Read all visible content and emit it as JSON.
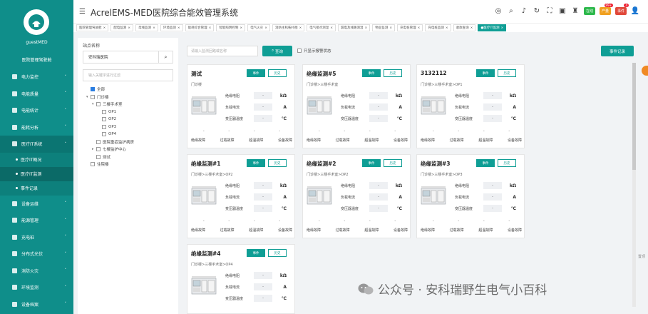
{
  "sidebar": {
    "user_name": "guestMED",
    "user_role": "医院管理驾驶舱",
    "items": [
      {
        "label": "电力监控",
        "icon": "lightning-icon"
      },
      {
        "label": "电能质量",
        "icon": "quality-icon"
      },
      {
        "label": "电能统计",
        "icon": "bar-chart-icon"
      },
      {
        "label": "能耗分析",
        "icon": "analysis-icon"
      },
      {
        "label": "医疗IT系统",
        "icon": "medical-icon",
        "open": true
      },
      {
        "label": "设备运维",
        "icon": "maintenance-icon"
      },
      {
        "label": "能源管理",
        "icon": "energy-icon"
      },
      {
        "label": "充电桩",
        "icon": "charger-icon"
      },
      {
        "label": "分布式光伏",
        "icon": "solar-icon"
      },
      {
        "label": "消防火灾",
        "icon": "fire-icon"
      },
      {
        "label": "环境监测",
        "icon": "environment-icon"
      },
      {
        "label": "设备档案",
        "icon": "archive-icon"
      },
      {
        "label": "运维管理",
        "icon": "ops-icon"
      }
    ],
    "sub_items": [
      {
        "label": "医疗IT概况"
      },
      {
        "label": "医疗IT监测",
        "active": true
      },
      {
        "label": "事件记录"
      }
    ]
  },
  "header": {
    "title": "AcrelEMS-MED医院综合能效管理系统",
    "badges": [
      {
        "label": "在线",
        "color": "#2db84c"
      },
      {
        "label": "产量",
        "color": "#f0a020",
        "count": "99+"
      },
      {
        "label": "事件",
        "color": "#e0483a",
        "count": "4"
      }
    ]
  },
  "tabs": [
    "医院管理驾驶舱",
    "配电监测",
    "母线监测",
    "环境监测",
    "能耗综合管理",
    "智能照明控制",
    "电气火灾",
    "消防主机拓扑图",
    "电气接点测温",
    "漏电及线路测温",
    "物业监测",
    "充电桩管理",
    "充电桩监测",
    "收款查询",
    "医疗IT监测"
  ],
  "tree": {
    "label": "站点名称",
    "selected_site": "安科瑞医院",
    "search_placeholder": "输入关键字进行过滤",
    "nodes": [
      {
        "label": "全部",
        "level": 0,
        "checked": true
      },
      {
        "label": "门诊楼",
        "level": 0,
        "toggle": "▾"
      },
      {
        "label": "三楼手术室",
        "level": 1,
        "toggle": "▾"
      },
      {
        "label": "OP1",
        "level": 2
      },
      {
        "label": "OP2",
        "level": 2
      },
      {
        "label": "OP3",
        "level": 2
      },
      {
        "label": "OP4",
        "level": 2
      },
      {
        "label": "医院重症监护病房",
        "level": 1
      },
      {
        "label": "七楼监护中心",
        "level": 1,
        "toggle": "▸"
      },
      {
        "label": "测试",
        "level": 1
      },
      {
        "label": "住院楼",
        "level": 0
      }
    ]
  },
  "toolbar": {
    "search_placeholder": "请输入监测回路或名称",
    "query_label": "查询",
    "only_abnormal_label": "只显示报警状态",
    "event_record_label": "事件记录"
  },
  "cards": [
    {
      "title": "测试",
      "btn1": "事件",
      "btn2": "历史",
      "path": "门诊楼",
      "metrics": [
        {
          "label": "绝缘电阻",
          "value": "-",
          "unit": "kΩ"
        },
        {
          "label": "负载电流",
          "value": "-",
          "unit": "A"
        },
        {
          "label": "变压器温度",
          "value": "-",
          "unit": "℃"
        }
      ],
      "alarms": [
        "绝缘故障",
        "过载故障",
        "超温故障",
        "设备故障"
      ]
    },
    {
      "title": "绝缘监测#5",
      "btn1": "事件",
      "btn2": "历史",
      "path": "门诊楼>三楼手术室",
      "metrics": [
        {
          "label": "绝缘电阻",
          "value": "-",
          "unit": "kΩ"
        },
        {
          "label": "负载电流",
          "value": "-",
          "unit": "A"
        },
        {
          "label": "变压器温度",
          "value": "-",
          "unit": "℃"
        }
      ],
      "alarms": [
        "绝缘故障",
        "过载故障",
        "超温故障",
        "设备故障"
      ]
    },
    {
      "title": "3132112",
      "btn1": "事件",
      "btn2": "历史",
      "path": "门诊楼>三楼手术室>OP1",
      "metrics": [
        {
          "label": "绝缘电阻",
          "value": "-",
          "unit": "kΩ"
        },
        {
          "label": "负载电流",
          "value": "-",
          "unit": "A"
        },
        {
          "label": "变压器温度",
          "value": "-",
          "unit": "℃"
        }
      ],
      "alarms": [
        "绝缘故障",
        "过载故障",
        "超温故障",
        "设备故障"
      ]
    },
    {
      "title": "绝缘监测#1",
      "btn1": "事件",
      "btn2": "历史",
      "path": "门诊楼>三楼手术室>OP2",
      "metrics": [
        {
          "label": "绝缘电阻",
          "value": "-",
          "unit": "kΩ"
        },
        {
          "label": "负载电流",
          "value": "-",
          "unit": "A"
        },
        {
          "label": "变压器温度",
          "value": "-",
          "unit": "℃"
        }
      ],
      "alarms": [
        "绝缘故障",
        "过载故障",
        "超温故障",
        "设备故障"
      ]
    },
    {
      "title": "绝缘监测#2",
      "btn1": "事件",
      "btn2": "历史",
      "path": "门诊楼>三楼手术室>OP2",
      "metrics": [
        {
          "label": "绝缘电阻",
          "value": "-",
          "unit": "kΩ"
        },
        {
          "label": "负载电流",
          "value": "-",
          "unit": "A"
        },
        {
          "label": "变压器温度",
          "value": "-",
          "unit": "℃"
        }
      ],
      "alarms": [
        "绝缘故障",
        "过载故障",
        "超温故障",
        "设备故障"
      ]
    },
    {
      "title": "绝缘监测#3",
      "btn1": "事件",
      "btn2": "历史",
      "path": "门诊楼>三楼手术室>OP3",
      "metrics": [
        {
          "label": "绝缘电阻",
          "value": "-",
          "unit": "kΩ"
        },
        {
          "label": "负载电流",
          "value": "-",
          "unit": "A"
        },
        {
          "label": "变压器温度",
          "value": "-",
          "unit": "℃"
        }
      ],
      "alarms": [
        "绝缘故障",
        "过载故障",
        "超温故障",
        "设备故障"
      ]
    },
    {
      "title": "绝缘监测#4",
      "btn1": "事件",
      "btn2": "历史",
      "path": "门诊楼>三楼手术室>OP4",
      "metrics": [
        {
          "label": "绝缘电阻",
          "value": "-",
          "unit": "kΩ"
        },
        {
          "label": "负载电流",
          "value": "-",
          "unit": "A"
        },
        {
          "label": "变压器温度",
          "value": "-",
          "unit": "℃"
        }
      ],
      "alarms": []
    }
  ],
  "side_tag": "置顶",
  "watermark": "公众号 · 安科瑞野生电气小百科",
  "colors": {
    "primary": "#0f9e95",
    "sidebar": "#0f8e8a"
  }
}
